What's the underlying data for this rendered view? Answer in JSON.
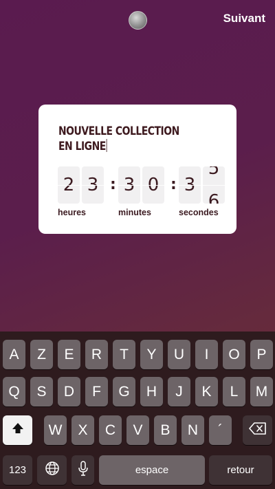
{
  "topbar": {
    "next_label": "Suivant"
  },
  "card": {
    "title": "NOUVELLE COLLECTION\nEN LIGNE",
    "digits": {
      "h1": "2",
      "h2": "3",
      "m1": "3",
      "m2": "0",
      "s1": "3",
      "s2_top": "5",
      "s2_bottom": "6"
    },
    "colon": ":",
    "units": {
      "hours": "heures",
      "minutes": "minutes",
      "seconds": "secondes"
    }
  },
  "keyboard": {
    "row1": [
      "A",
      "Z",
      "E",
      "R",
      "T",
      "Y",
      "U",
      "I",
      "O",
      "P"
    ],
    "row2": [
      "Q",
      "S",
      "D",
      "F",
      "G",
      "H",
      "J",
      "K",
      "L",
      "M"
    ],
    "row3": [
      "W",
      "X",
      "C",
      "V",
      "B",
      "N",
      "´"
    ],
    "numbers_label": "123",
    "space_label": "espace",
    "return_label": "retour",
    "icons": {
      "shift": "shift-icon",
      "backspace": "backspace-icon",
      "globe": "globe-icon",
      "mic": "microphone-icon"
    }
  }
}
